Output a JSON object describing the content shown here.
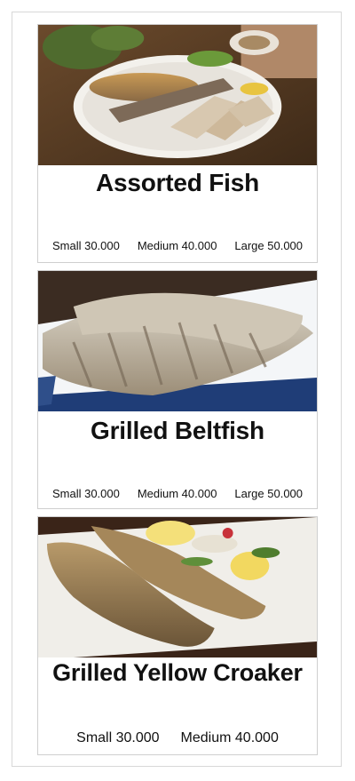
{
  "menu": {
    "items": [
      {
        "name": "Assorted Fish",
        "image_icon": "assorted-fish-plate-photo",
        "prices": [
          "Small 30.000",
          "Medium 40.000",
          "Large 50.000"
        ]
      },
      {
        "name": "Grilled Beltfish",
        "image_icon": "grilled-beltfish-photo",
        "prices": [
          "Small 30.000",
          "Medium 40.000",
          "Large 50.000"
        ]
      },
      {
        "name": "Grilled Yellow Croaker",
        "image_icon": "grilled-yellow-croaker-photo",
        "prices": [
          "Small 30.000",
          "Medium 40.000"
        ]
      }
    ]
  },
  "colors": {
    "frame_border": "#d8d8d8",
    "card_border": "#cfcfcf",
    "text": "#111111"
  }
}
